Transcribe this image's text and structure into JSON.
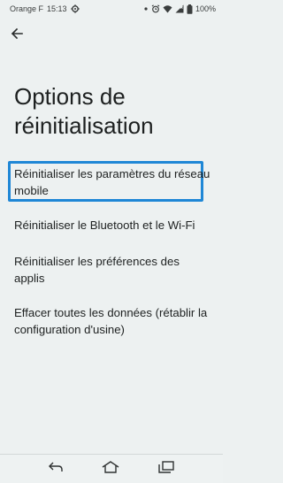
{
  "status_bar": {
    "carrier": "Orange F",
    "time": "15:13",
    "battery": "100%",
    "icons": [
      "gear-icon",
      "notification-dot-icon",
      "alarm-icon",
      "wifi-icon",
      "signal-icon",
      "battery-icon"
    ]
  },
  "header": {
    "back_icon": "arrow-left-icon",
    "title": "Options de réinitialisation"
  },
  "options": [
    {
      "label": "Réinitialiser les paramètres du réseau mobile",
      "highlighted": true
    },
    {
      "label": "Réinitialiser le Bluetooth et le Wi-Fi",
      "highlighted": false
    },
    {
      "label": "Réinitialiser les préférences des applis",
      "highlighted": false
    },
    {
      "label": "Effacer toutes les données (rétablir la configuration d'usine)",
      "highlighted": false
    }
  ],
  "nav_bar": {
    "icons": [
      "back-icon",
      "home-icon",
      "recents-icon"
    ]
  },
  "colors": {
    "background": "#edf1f1",
    "highlight": "#1f87d6",
    "text": "#202323"
  }
}
